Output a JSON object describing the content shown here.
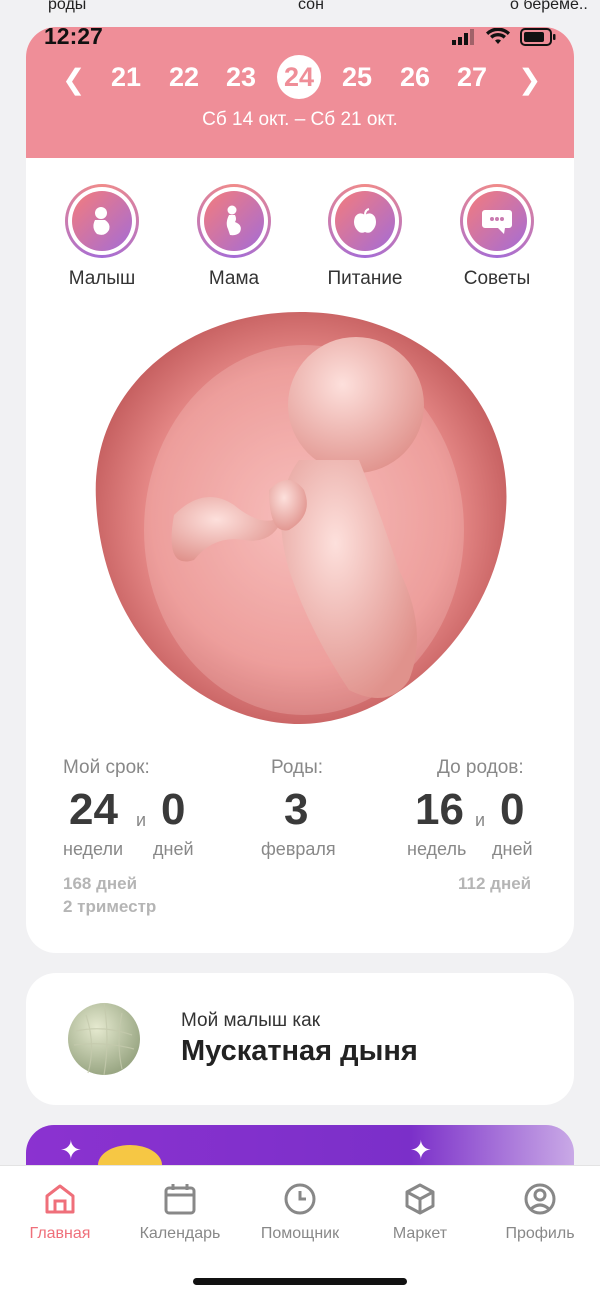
{
  "overflow_labels": [
    "роды",
    "сон",
    "о береме.."
  ],
  "status": {
    "time": "12:27"
  },
  "weeks": {
    "items": [
      "21",
      "22",
      "23",
      "24",
      "25",
      "26",
      "27"
    ],
    "active": "24",
    "date_range": "Сб 14 окт. – Сб 21 окт."
  },
  "categories": [
    {
      "label": "Малыш",
      "icon": "baby-icon"
    },
    {
      "label": "Мама",
      "icon": "pregnant-icon"
    },
    {
      "label": "Питание",
      "icon": "apple-icon"
    },
    {
      "label": "Советы",
      "icon": "chat-icon"
    }
  ],
  "stats": {
    "term": {
      "label": "Мой срок:",
      "weeks": "24",
      "and": "и",
      "days": "0",
      "weeks_unit": "недели",
      "days_unit": "дней",
      "total_days": "168 дней",
      "trimester": "2 триместр"
    },
    "birth": {
      "label": "Роды:",
      "day": "3",
      "month": "февраля"
    },
    "remaining": {
      "label": "До родов:",
      "weeks": "16",
      "and": "и",
      "days": "0",
      "weeks_unit": "недель",
      "days_unit": "дней",
      "total_days": "112 дней"
    }
  },
  "fruit": {
    "caption": "Мой малыш как",
    "name": "Мускатная дыня"
  },
  "tabs": [
    {
      "label": "Главная",
      "icon": "home-icon",
      "active": true
    },
    {
      "label": "Календарь",
      "icon": "calendar-icon",
      "active": false
    },
    {
      "label": "Помощник",
      "icon": "clock-icon",
      "active": false
    },
    {
      "label": "Маркет",
      "icon": "box-icon",
      "active": false
    },
    {
      "label": "Профиль",
      "icon": "profile-icon",
      "active": false
    }
  ],
  "colors": {
    "accent": "#ef8e98",
    "tab_active": "#ef6f7a",
    "banner": "#8b32d0"
  }
}
